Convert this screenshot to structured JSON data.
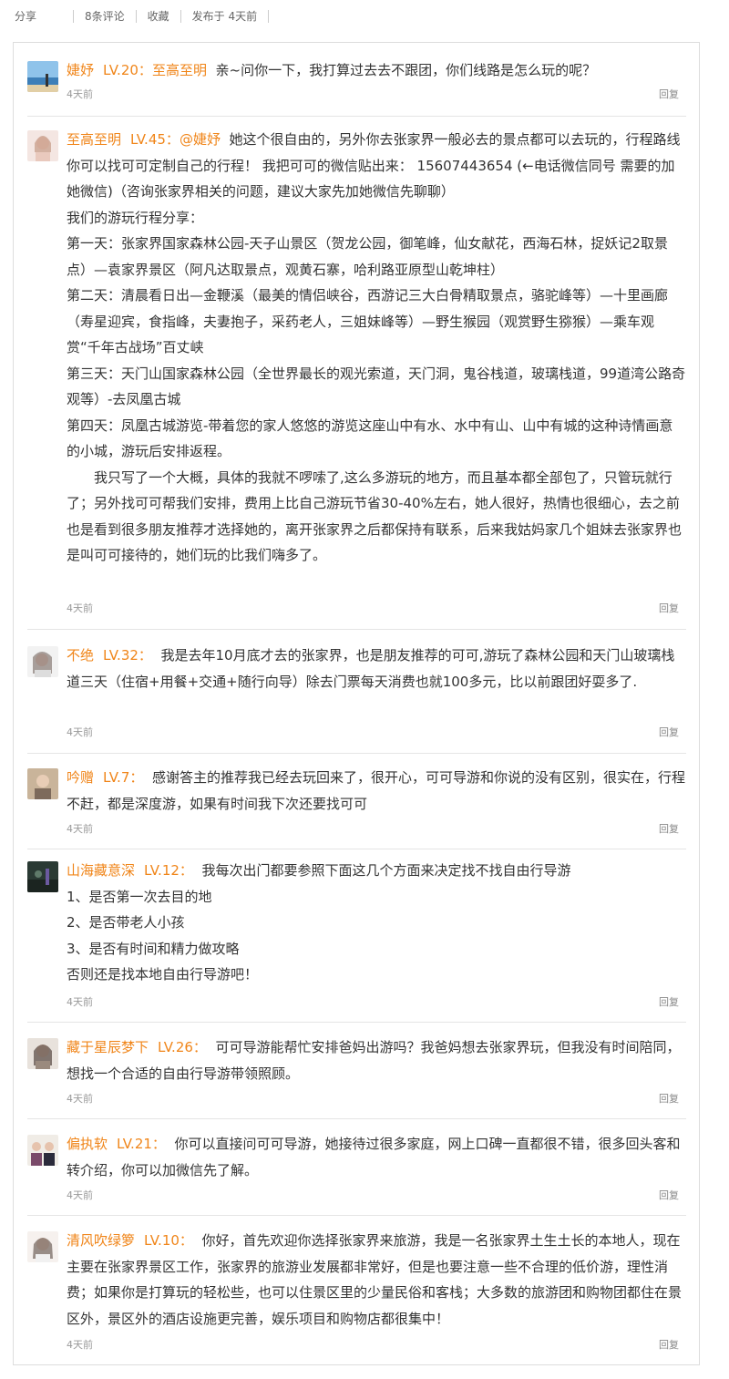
{
  "topbar": {
    "share": "分享",
    "comments": "8条评论",
    "favorite": "收藏",
    "posted": "发布于 4天前"
  },
  "reply_label": "回复",
  "comments": [
    {
      "user": "婕妤",
      "level": "LV.20",
      "reply_to_prefix": "：",
      "reply_to": "至高至明",
      "paragraphs": [
        "亲~问你一下，我打算过去去不跟团，你们线路是怎么玩的呢？"
      ],
      "time": "4天前"
    },
    {
      "user": "至高至明",
      "level": "LV.45",
      "reply_to_prefix": "：",
      "reply_to": "@婕妤",
      "paragraphs": [
        "她这个很自由的，另外你去张家界一般必去的景点都可以去玩的，行程路线你可以找可可定制自己的行程！ 我把可可的微信贴出来： 15607443654 (←电话微信同号 需要的加她微信)（咨询张家界相关的问题，建议大家先加她微信先聊聊）",
        "我们的游玩行程分享：",
        "第一天：张家界国家森林公园-天子山景区（贺龙公园，御笔峰，仙女献花，西海石林，捉妖记2取景点）—袁家界景区（阿凡达取景点，观黄石寨，哈利路亚原型山乾坤柱）",
        "第二天：清晨看日出—金鞭溪（最美的情侣峡谷，西游记三大白骨精取景点，骆驼峰等）—十里画廊（寿星迎宾，食指峰，夫妻抱子，采药老人，三姐妹峰等）—野生猴园（观赏野生猕猴）—乘车观赏“千年古战场”百丈峡",
        "第三天：天门山国家森林公园（全世界最长的观光索道，天门洞，鬼谷栈道，玻璃栈道，99道湾公路奇观等）-去凤凰古城",
        "第四天：凤凰古城游览-带着您的家人悠悠的游览这座山中有水、水中有山、山中有城的这种诗情画意的小城，游玩后安排返程。",
        "我只写了一个大概，具体的我就不啰嗦了,这么多游玩的地方，而且基本都全部包了，只管玩就行了；另外找可可帮我们安排，费用上比自己游玩节省30-40%左右，她人很好，热情也很细心，去之前也是看到很多朋友推荐才选择她的，离开张家界之后都保持有联系，后来我姑妈家几个姐妹去张家界也是叫可可接待的，她们玩的比我们嗨多了。"
      ],
      "time": "4天前"
    },
    {
      "user": "不绝",
      "level": "LV.32",
      "paragraphs": [
        "我是去年10月底才去的张家界，也是朋友推荐的可可,游玩了森林公园和天门山玻璃栈道三天（住宿+用餐+交通+随行向导）除去门票每天消费也就100多元，比以前跟团好耍多了."
      ],
      "time": "4天前"
    },
    {
      "user": "吟赠",
      "level": "LV.7",
      "paragraphs": [
        "感谢答主的推荐我已经去玩回来了，很开心，可可导游和你说的没有区别，很实在，行程不赶，都是深度游，如果有时间我下次还要找可可"
      ],
      "time": "4天前"
    },
    {
      "user": "山海藏意深",
      "level": "LV.12",
      "paragraphs": [
        "我每次出门都要参照下面这几个方面来决定找不找自由行导游",
        "1、是否第一次去目的地",
        "2、是否带老人小孩",
        "3、是否有时间和精力做攻略",
        "否则还是找本地自由行导游吧！"
      ],
      "time": "4天前"
    },
    {
      "user": "藏于星辰梦下",
      "level": "LV.26",
      "paragraphs": [
        "可可导游能帮忙安排爸妈出游吗？我爸妈想去张家界玩，但我没有时间陪同，想找一个合适的自由行导游带领照顾。"
      ],
      "time": "4天前"
    },
    {
      "user": "偏执软",
      "level": "LV.21",
      "paragraphs": [
        "你可以直接问可可导游，她接待过很多家庭，网上口碑一直都很不错，很多回头客和转介绍，你可以加微信先了解。"
      ],
      "time": "4天前"
    },
    {
      "user": "清风吹绿箩",
      "level": "LV.10",
      "paragraphs": [
        "你好，首先欢迎你选择张家界来旅游，我是一名张家界土生土长的本地人，现在主要在张家界景区工作，张家界的旅游业发展都非常好，但是也要注意一些不合理的低价游，理性消费；如果你是打算玩的轻松些，也可以住景区里的少量民俗和客栈；大多数的旅游团和购物团都住在景区外，景区外的酒店设施更完善，娱乐项目和购物店都很集中！"
      ],
      "time": "4天前"
    }
  ],
  "colors": {
    "accent": "#f08519",
    "text": "#333333",
    "muted": "#999999",
    "divider": "#e5e5e5",
    "border": "#dddddd"
  },
  "avatar_icons": [
    "beach-avatar-icon",
    "woman-avatar-icon",
    "woman-avatar-icon",
    "person-avatar-icon",
    "dark-scene-avatar-icon",
    "girl-avatar-icon",
    "group-avatar-icon",
    "woman-avatar-icon"
  ]
}
